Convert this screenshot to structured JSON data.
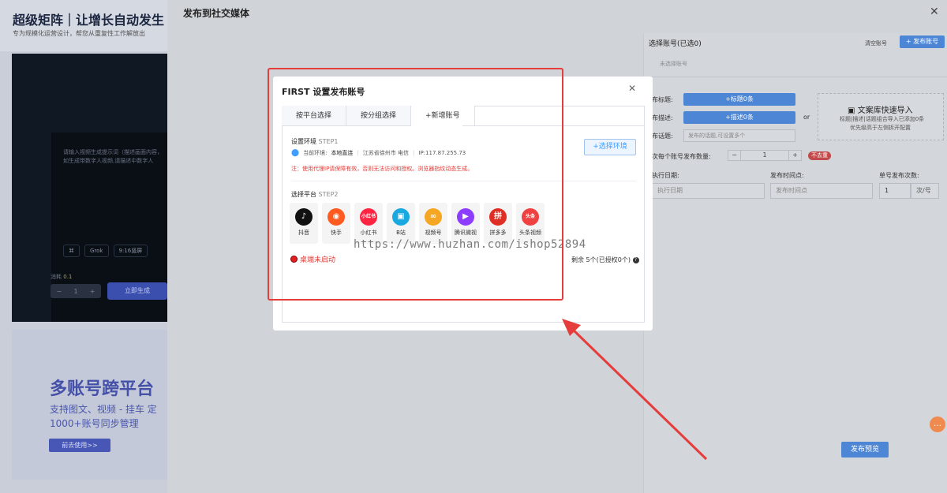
{
  "background": {
    "title": "超级矩阵｜让增长自动发生",
    "subtitle": "专为规模化运营设计，帮您从重复性工作解放出",
    "video_text": "请输入视频生成提示词（描述画面内容，如生成带数字人视频,请描述中数字人",
    "chips": [
      "Grok",
      "9:16竖屏"
    ],
    "score_label": "消耗",
    "score_value": "0.1",
    "step_minus": "−",
    "step_value": "1",
    "step_plus": "+",
    "generate_button": "立即生成",
    "promo_title": "多账号跨平台",
    "promo_line1": "支持图文、视频 - 挂车 定",
    "promo_line2": "1000+账号同步管理",
    "try_button": "前去使用>>"
  },
  "drawer": {
    "title": "发布到社交媒体",
    "close": "✕",
    "selected_header": "选择账号(已选0)",
    "clear_label": "清空账号",
    "publish_button": "+ 发布账号",
    "none_selected": "未选择账号",
    "title_label": "发布标题:",
    "title_btn": "+标题0条",
    "desc_label": "发布描述:",
    "desc_btn": "+描述0条",
    "topic_label": "发布话题:",
    "topic_placeholder": "发布的话题,可设置多个",
    "or": "or",
    "import_title": "文案库快速导入",
    "import_desc1": "标题|描述|话题组合导入已添加0条",
    "import_desc2": "优先级高于左侧拆开配置",
    "count_label": "单次每个账号发布数量:",
    "count_minus": "−",
    "count_value": "1",
    "count_plus": "+",
    "no_repeat": "不去重",
    "date_label": "执行日期:",
    "date_placeholder": "执行日期",
    "time_label": "发布时间点:",
    "time_placeholder": "发布时间点",
    "times_label": "单号发布次数:",
    "times_value": "1",
    "times_unit": "次/号",
    "preview_button": "发布预览"
  },
  "modal": {
    "title": "FIRST 设置发布账号",
    "close": "✕",
    "tabs": [
      "按平台选择",
      "按分组选择",
      "+新增账号"
    ],
    "active_tab": 2,
    "step1_label": "设置环境",
    "step1_tag": "STEP1",
    "env_prefix": "当前环境:",
    "env_name": "本地直连",
    "env_location": "江苏省徐州市 电信",
    "env_ip": "IP:117.87.255.73",
    "warning": "注：使用代理IP请保障有效，否则无法访问和授权。浏览器指纹动态生成。",
    "select_env_button": "+选择环境",
    "step2_label": "选择平台",
    "step2_tag": "STEP2",
    "platforms": [
      {
        "name": "抖音",
        "icon": "douyin-icon",
        "color": "#111111",
        "glyph": "♪"
      },
      {
        "name": "快手",
        "icon": "kuaishou-icon",
        "color": "#ff5a1f",
        "glyph": "◉"
      },
      {
        "name": "小红书",
        "icon": "xiaohongshu-icon",
        "color": "#ff2442",
        "glyph": "小红书"
      },
      {
        "name": "B站",
        "icon": "bilibili-icon",
        "color": "#19a8e0",
        "glyph": "▣"
      },
      {
        "name": "视频号",
        "icon": "shipinhao-icon",
        "color": "#f5a623",
        "glyph": "∞"
      },
      {
        "name": "腾讯微视",
        "icon": "weishi-icon",
        "color": "#8c3dff",
        "glyph": "▶"
      },
      {
        "name": "拼多多",
        "icon": "pinduoduo-icon",
        "color": "#e02e24",
        "glyph": "拼"
      },
      {
        "name": "头条视频",
        "icon": "toutiao-icon",
        "color": "#f04142",
        "glyph": "头条"
      }
    ],
    "status": "桌端未启动",
    "remaining": "剩余 5个(已授权0个)"
  },
  "watermark": "https://www.huzhan.com/ishop52894",
  "colors": {
    "accent": "#409eff",
    "annotation": "#e53c3c",
    "warning": "#e53935"
  }
}
